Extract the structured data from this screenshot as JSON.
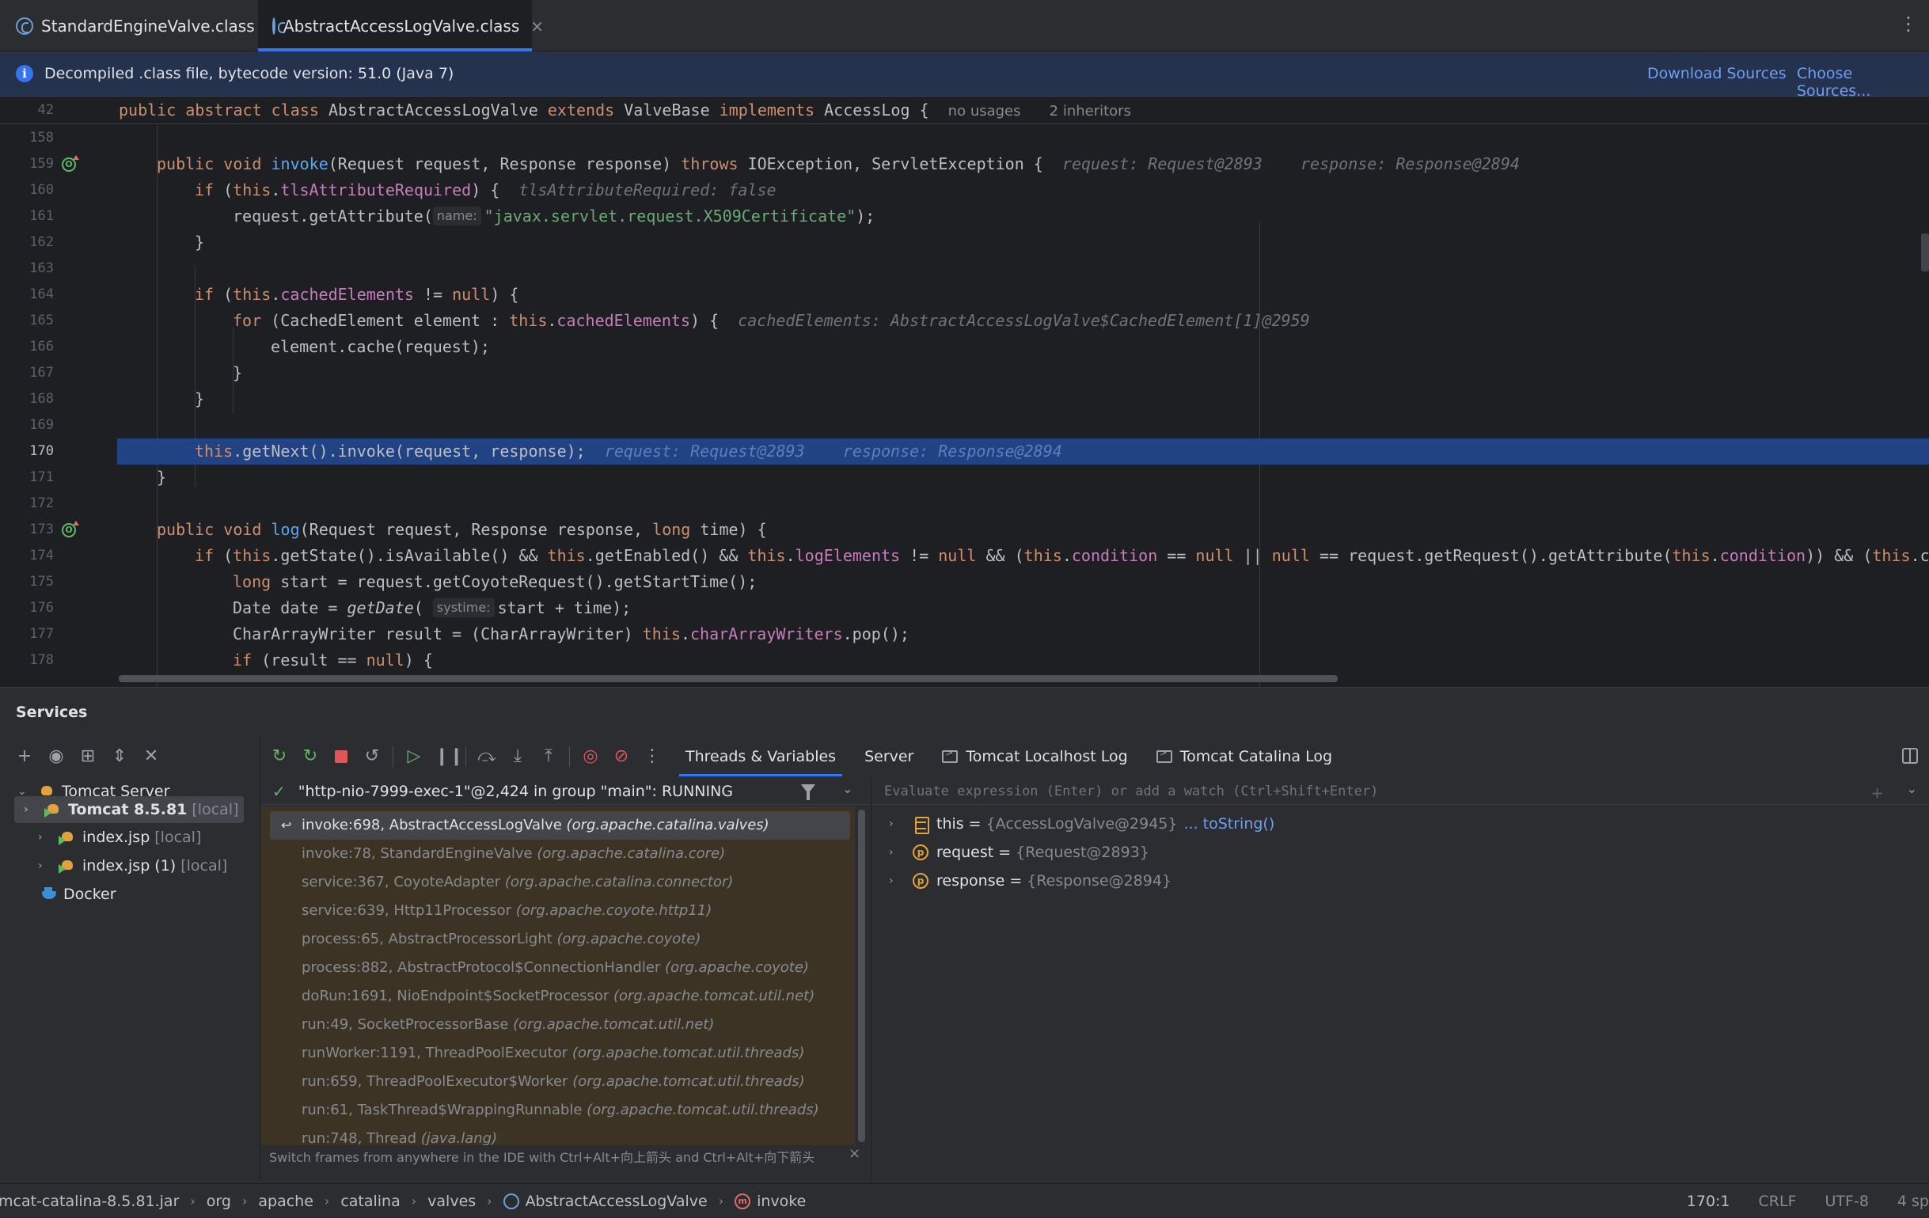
{
  "tabs": [
    {
      "label": "StandardEngineValve.class",
      "active": false
    },
    {
      "label": "AbstractAccessLogValve.class",
      "active": true
    }
  ],
  "tab_close": "×",
  "tab_more": "⋮",
  "banner": {
    "message": "Decompiled .class file, bytecode version: 51.0 (Java 7)",
    "download_sources": "Download Sources",
    "choose_sources": "Choose Sources..."
  },
  "sticky": {
    "line_number": "42",
    "meta_usages": "no usages",
    "meta_inheritors": "2 inheritors"
  },
  "editor_lines": [
    {
      "n": "158"
    },
    {
      "n": "159"
    },
    {
      "n": "160"
    },
    {
      "n": "161"
    },
    {
      "n": "162"
    },
    {
      "n": "163"
    },
    {
      "n": "164"
    },
    {
      "n": "165"
    },
    {
      "n": "166"
    },
    {
      "n": "167"
    },
    {
      "n": "168"
    },
    {
      "n": "169"
    },
    {
      "n": "170"
    },
    {
      "n": "171"
    },
    {
      "n": "172"
    },
    {
      "n": "173"
    },
    {
      "n": "174"
    },
    {
      "n": "175"
    },
    {
      "n": "176"
    },
    {
      "n": "177"
    },
    {
      "n": "178"
    }
  ],
  "code": {
    "sticky_decl": [
      "public",
      "abstract",
      "class",
      "AbstractAccessLogValve",
      "extends",
      "ValveBase",
      "implements",
      "AccessLog {"
    ],
    "hint_159_req": "request: Request@2893",
    "hint_159_resp": "response: Response@2894",
    "hint_160": "tlsAttributeRequired: false",
    "param_name": "name:",
    "str_161": "\"javax.servlet.request.X509Certificate\"",
    "hint_165": "cachedElements: AbstractAccessLogValve$CachedElement[1]@2959",
    "hint_170_req": "request: Request@2893",
    "hint_170_resp": "response: Response@2894",
    "param_systime": "systime:"
  },
  "services": {
    "title": "Services",
    "tree": [
      {
        "label": "Tomcat Server",
        "muted": ""
      },
      {
        "label": "Tomcat 8.5.81",
        "muted": "[local]"
      },
      {
        "label": "index.jsp",
        "muted": "[local]"
      },
      {
        "label": "index.jsp (1)",
        "muted": "[local]"
      },
      {
        "label": "Docker",
        "muted": ""
      }
    ],
    "debug_tabs": [
      "Threads & Variables",
      "Server",
      "Tomcat Localhost Log",
      "Tomcat Catalina Log"
    ],
    "thread": "\"http-nio-7999-exec-1\"@2,424 in group \"main\": RUNNING",
    "frames": [
      {
        "loc": "invoke:698, AbstractAccessLogValve",
        "pkg": "(org.apache.catalina.valves)"
      },
      {
        "loc": "invoke:78, StandardEngineValve",
        "pkg": "(org.apache.catalina.core)"
      },
      {
        "loc": "service:367, CoyoteAdapter",
        "pkg": "(org.apache.catalina.connector)"
      },
      {
        "loc": "service:639, Http11Processor",
        "pkg": "(org.apache.coyote.http11)"
      },
      {
        "loc": "process:65, AbstractProcessorLight",
        "pkg": "(org.apache.coyote)"
      },
      {
        "loc": "process:882, AbstractProtocol$ConnectionHandler",
        "pkg": "(org.apache.coyote)"
      },
      {
        "loc": "doRun:1691, NioEndpoint$SocketProcessor",
        "pkg": "(org.apache.tomcat.util.net)"
      },
      {
        "loc": "run:49, SocketProcessorBase",
        "pkg": "(org.apache.tomcat.util.net)"
      },
      {
        "loc": "runWorker:1191, ThreadPoolExecutor",
        "pkg": "(org.apache.tomcat.util.threads)"
      },
      {
        "loc": "run:659, ThreadPoolExecutor$Worker",
        "pkg": "(org.apache.tomcat.util.threads)"
      },
      {
        "loc": "run:61, TaskThread$WrappingRunnable",
        "pkg": "(org.apache.tomcat.util.threads)"
      },
      {
        "loc": "run:748, Thread",
        "pkg": "(java.lang)"
      }
    ],
    "frames_hint": "Switch frames from anywhere in the IDE with Ctrl+Alt+向上箭头 and Ctrl+Alt+向下箭头",
    "eval_placeholder": "Evaluate expression (Enter) or add a watch (Ctrl+Shift+Enter)",
    "variables": [
      {
        "name": "this",
        "value": "{AccessLogValve@2945}",
        "link": "... toString()"
      },
      {
        "name": "request",
        "value": "{Request@2893}",
        "link": ""
      },
      {
        "name": "response",
        "value": "{Response@2894}",
        "link": ""
      }
    ]
  },
  "statusbar": {
    "crumbs": [
      "mcat-catalina-8.5.81.jar",
      "org",
      "apache",
      "catalina",
      "valves",
      "AbstractAccessLogValve",
      "invoke"
    ],
    "position": "170:1",
    "line_sep": "CRLF",
    "encoding": "UTF-8",
    "indent": "4 sp"
  },
  "colors": {
    "accent": "#3574f0",
    "keyword": "#cf8e6d",
    "method": "#56a8f5",
    "field": "#c77dbb",
    "string": "#6aab73",
    "frames_bg": "#3d3324",
    "highlight_line": "#214283"
  }
}
